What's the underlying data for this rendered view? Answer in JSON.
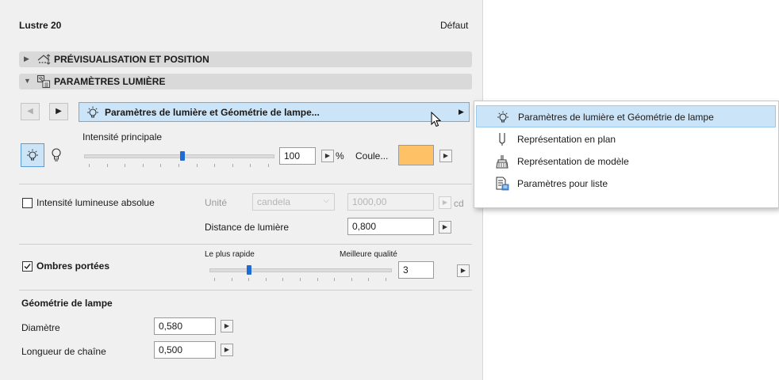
{
  "panel": {
    "title": "Lustre 20",
    "preset": "Défaut"
  },
  "sections": {
    "preview": "PRÉVISUALISATION ET POSITION",
    "light": "PARAMÈTRES LUMIÈRE"
  },
  "page_selector": {
    "label": "Paramètres de lumière et Géométrie de lampe..."
  },
  "intensity": {
    "label": "Intensité principale",
    "value": "100",
    "unit": "%",
    "color_label": "Coule...",
    "color_swatch": "#ffc166",
    "slider_fraction": 0.52
  },
  "absolute": {
    "checkbox_label": "Intensité lumineuse absolue",
    "checked": false,
    "unit_label": "Unité",
    "unit_value": "candela",
    "value": "1000,00",
    "value_unit": "cd",
    "distance_label": "Distance de lumière",
    "distance_value": "0,800"
  },
  "shadows": {
    "checkbox_label": "Ombres portées",
    "checked": true,
    "fast_label": "Le plus rapide",
    "best_label": "Meilleure qualité",
    "value": "3",
    "slider_fraction": 0.22
  },
  "geometry": {
    "heading": "Géométrie de lampe",
    "diameter_label": "Diamètre",
    "diameter_value": "0,580",
    "chain_label": "Longueur de chaîne",
    "chain_value": "0,500"
  },
  "menu": {
    "items": [
      {
        "label": "Paramètres de lumière et Géométrie de lampe",
        "icon": "light-bulb-icon",
        "highlighted": true
      },
      {
        "label": "Représentation en plan",
        "icon": "plan-symbol-icon",
        "highlighted": false
      },
      {
        "label": "Représentation de modèle",
        "icon": "model-brush-icon",
        "highlighted": false
      },
      {
        "label": "Paramètres pour liste",
        "icon": "listing-icon",
        "highlighted": false
      }
    ]
  },
  "colors": {
    "panel_bg": "#f0f0f0",
    "section_bg": "#d9d9d9",
    "selector_bg": "#cce4f7",
    "accent": "#1e6ad6"
  }
}
